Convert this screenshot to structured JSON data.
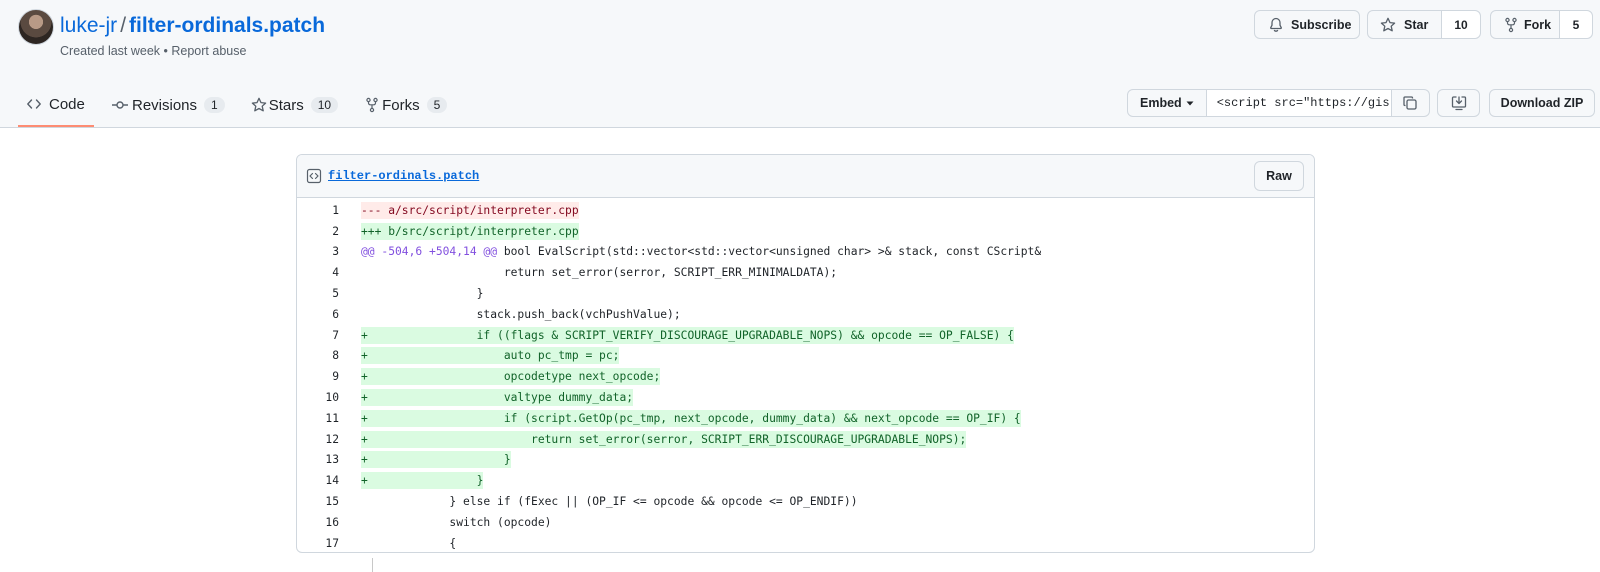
{
  "header": {
    "owner": "luke-jr",
    "separator": "/",
    "repo": "filter-ordinals.patch",
    "subtitle": "Created last week • Report abuse",
    "subscribe_label": "Subscribe",
    "star_label": "Star",
    "star_count": "10",
    "fork_label": "Fork",
    "fork_count": "5"
  },
  "tabs": [
    {
      "label": "Code",
      "icon": "code-icon",
      "active": true
    },
    {
      "label": "Revisions",
      "icon": "commit-icon",
      "count": "1"
    },
    {
      "label": "Stars",
      "icon": "star-icon",
      "count": "10"
    },
    {
      "label": "Forks",
      "icon": "fork-icon",
      "count": "5"
    }
  ],
  "embed": {
    "label": "Embed",
    "value": "<script src=\"https://gis",
    "download_zip_label": "Download ZIP"
  },
  "file": {
    "name": "filter-ordinals.patch",
    "raw_label": "Raw",
    "lines": [
      {
        "n": "1",
        "text": "--- a/src/script/interpreter.cpp",
        "type": "del"
      },
      {
        "n": "2",
        "text": "+++ b/src/script/interpreter.cpp",
        "type": "add"
      },
      {
        "n": "3",
        "hunk": "@@ -504,6 +504,14 @@",
        "text": " bool EvalScript(std::vector<std::vector<unsigned char> >& stack, const CScript&",
        "type": "hunk"
      },
      {
        "n": "4",
        "text": "                     return set_error(serror, SCRIPT_ERR_MINIMALDATA);",
        "type": "ctx"
      },
      {
        "n": "5",
        "text": "                 }",
        "type": "ctx"
      },
      {
        "n": "6",
        "text": "                 stack.push_back(vchPushValue);",
        "type": "ctx"
      },
      {
        "n": "7",
        "text": "+                if ((flags & SCRIPT_VERIFY_DISCOURAGE_UPGRADABLE_NOPS) && opcode == OP_FALSE) {",
        "type": "add"
      },
      {
        "n": "8",
        "text": "+                    auto pc_tmp = pc;",
        "type": "add"
      },
      {
        "n": "9",
        "text": "+                    opcodetype next_opcode;",
        "type": "add"
      },
      {
        "n": "10",
        "text": "+                    valtype dummy_data;",
        "type": "add"
      },
      {
        "n": "11",
        "text": "+                    if (script.GetOp(pc_tmp, next_opcode, dummy_data) && next_opcode == OP_IF) {",
        "type": "add"
      },
      {
        "n": "12",
        "text": "+                        return set_error(serror, SCRIPT_ERR_DISCOURAGE_UPGRADABLE_NOPS);",
        "type": "add"
      },
      {
        "n": "13",
        "text": "+                    }",
        "type": "add"
      },
      {
        "n": "14",
        "text": "+                }",
        "type": "add"
      },
      {
        "n": "15",
        "text": "             } else if (fExec || (OP_IF <= opcode && opcode <= OP_ENDIF))",
        "type": "ctx"
      },
      {
        "n": "16",
        "text": "             switch (opcode)",
        "type": "ctx"
      },
      {
        "n": "17",
        "text": "             {",
        "type": "ctx"
      }
    ]
  }
}
